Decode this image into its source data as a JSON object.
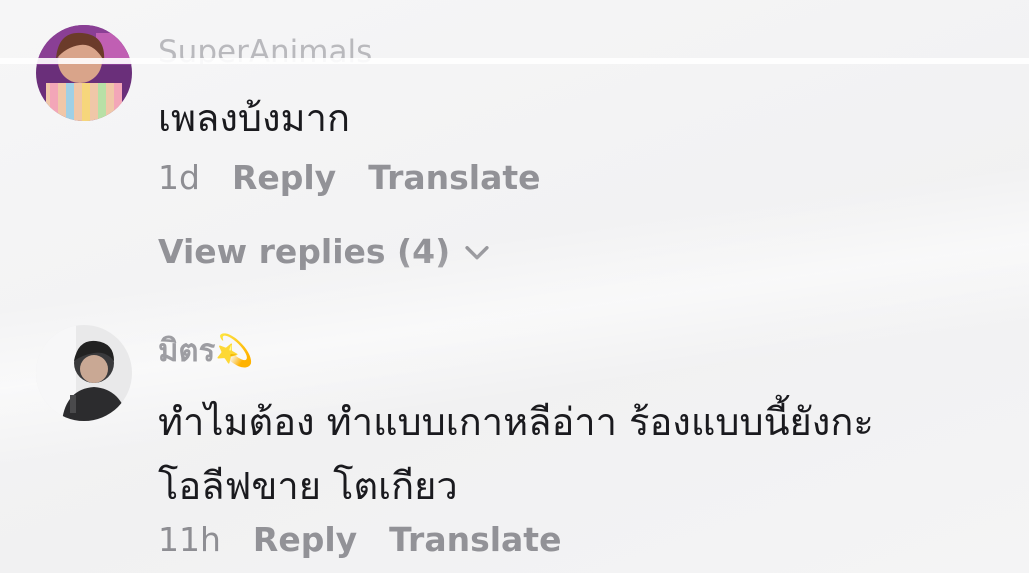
{
  "comments": [
    {
      "username": "SuperAnimals",
      "text": "เพลงบ้งมาก",
      "time": "1d",
      "reply_label": "Reply",
      "translate_label": "Translate",
      "view_replies_label": "View replies (4)",
      "avatar_icon": "avatar-girl-icon"
    },
    {
      "username": "มิตร💫",
      "text_line1": "ทำไมต้อง ทำแบบเกาหลีอ่าา ร้องแบบนี้ยังกะ",
      "text_line2": "โอลีฟขาย โตเกียว",
      "time": "11h",
      "reply_label": "Reply",
      "translate_label": "Translate",
      "avatar_icon": "avatar-man-icon"
    }
  ],
  "colors": {
    "background": "#f4f4f5",
    "text": "#1a1a1e",
    "meta": "#8e8e93"
  }
}
